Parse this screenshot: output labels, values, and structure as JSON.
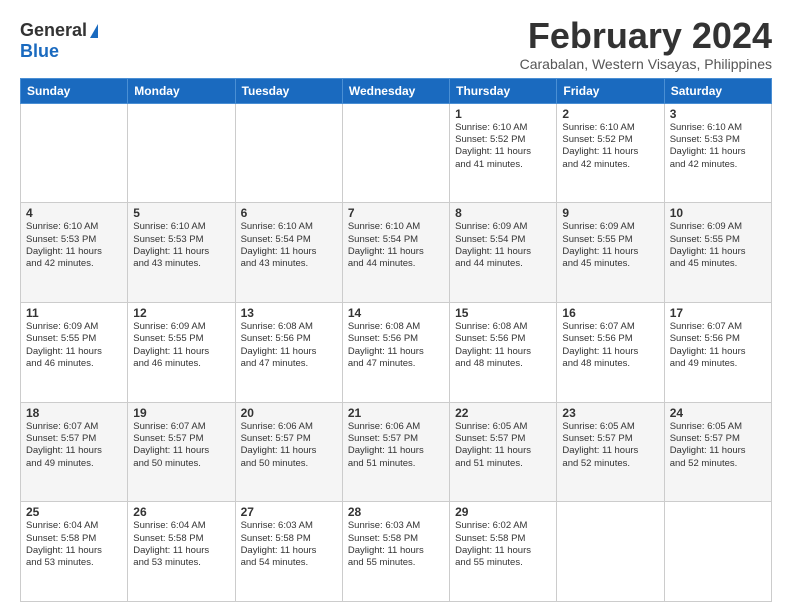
{
  "logo": {
    "general": "General",
    "blue": "Blue"
  },
  "title": {
    "month_year": "February 2024",
    "location": "Carabalan, Western Visayas, Philippines"
  },
  "days_of_week": [
    "Sunday",
    "Monday",
    "Tuesday",
    "Wednesday",
    "Thursday",
    "Friday",
    "Saturday"
  ],
  "weeks": [
    {
      "style": "row-white",
      "days": [
        {
          "num": "",
          "info": ""
        },
        {
          "num": "",
          "info": ""
        },
        {
          "num": "",
          "info": ""
        },
        {
          "num": "",
          "info": ""
        },
        {
          "num": "1",
          "info": "Sunrise: 6:10 AM\nSunset: 5:52 PM\nDaylight: 11 hours\nand 41 minutes."
        },
        {
          "num": "2",
          "info": "Sunrise: 6:10 AM\nSunset: 5:52 PM\nDaylight: 11 hours\nand 42 minutes."
        },
        {
          "num": "3",
          "info": "Sunrise: 6:10 AM\nSunset: 5:53 PM\nDaylight: 11 hours\nand 42 minutes."
        }
      ]
    },
    {
      "style": "row-gray",
      "days": [
        {
          "num": "4",
          "info": "Sunrise: 6:10 AM\nSunset: 5:53 PM\nDaylight: 11 hours\nand 42 minutes."
        },
        {
          "num": "5",
          "info": "Sunrise: 6:10 AM\nSunset: 5:53 PM\nDaylight: 11 hours\nand 43 minutes."
        },
        {
          "num": "6",
          "info": "Sunrise: 6:10 AM\nSunset: 5:54 PM\nDaylight: 11 hours\nand 43 minutes."
        },
        {
          "num": "7",
          "info": "Sunrise: 6:10 AM\nSunset: 5:54 PM\nDaylight: 11 hours\nand 44 minutes."
        },
        {
          "num": "8",
          "info": "Sunrise: 6:09 AM\nSunset: 5:54 PM\nDaylight: 11 hours\nand 44 minutes."
        },
        {
          "num": "9",
          "info": "Sunrise: 6:09 AM\nSunset: 5:55 PM\nDaylight: 11 hours\nand 45 minutes."
        },
        {
          "num": "10",
          "info": "Sunrise: 6:09 AM\nSunset: 5:55 PM\nDaylight: 11 hours\nand 45 minutes."
        }
      ]
    },
    {
      "style": "row-white",
      "days": [
        {
          "num": "11",
          "info": "Sunrise: 6:09 AM\nSunset: 5:55 PM\nDaylight: 11 hours\nand 46 minutes."
        },
        {
          "num": "12",
          "info": "Sunrise: 6:09 AM\nSunset: 5:55 PM\nDaylight: 11 hours\nand 46 minutes."
        },
        {
          "num": "13",
          "info": "Sunrise: 6:08 AM\nSunset: 5:56 PM\nDaylight: 11 hours\nand 47 minutes."
        },
        {
          "num": "14",
          "info": "Sunrise: 6:08 AM\nSunset: 5:56 PM\nDaylight: 11 hours\nand 47 minutes."
        },
        {
          "num": "15",
          "info": "Sunrise: 6:08 AM\nSunset: 5:56 PM\nDaylight: 11 hours\nand 48 minutes."
        },
        {
          "num": "16",
          "info": "Sunrise: 6:07 AM\nSunset: 5:56 PM\nDaylight: 11 hours\nand 48 minutes."
        },
        {
          "num": "17",
          "info": "Sunrise: 6:07 AM\nSunset: 5:56 PM\nDaylight: 11 hours\nand 49 minutes."
        }
      ]
    },
    {
      "style": "row-gray",
      "days": [
        {
          "num": "18",
          "info": "Sunrise: 6:07 AM\nSunset: 5:57 PM\nDaylight: 11 hours\nand 49 minutes."
        },
        {
          "num": "19",
          "info": "Sunrise: 6:07 AM\nSunset: 5:57 PM\nDaylight: 11 hours\nand 50 minutes."
        },
        {
          "num": "20",
          "info": "Sunrise: 6:06 AM\nSunset: 5:57 PM\nDaylight: 11 hours\nand 50 minutes."
        },
        {
          "num": "21",
          "info": "Sunrise: 6:06 AM\nSunset: 5:57 PM\nDaylight: 11 hours\nand 51 minutes."
        },
        {
          "num": "22",
          "info": "Sunrise: 6:05 AM\nSunset: 5:57 PM\nDaylight: 11 hours\nand 51 minutes."
        },
        {
          "num": "23",
          "info": "Sunrise: 6:05 AM\nSunset: 5:57 PM\nDaylight: 11 hours\nand 52 minutes."
        },
        {
          "num": "24",
          "info": "Sunrise: 6:05 AM\nSunset: 5:57 PM\nDaylight: 11 hours\nand 52 minutes."
        }
      ]
    },
    {
      "style": "row-white",
      "days": [
        {
          "num": "25",
          "info": "Sunrise: 6:04 AM\nSunset: 5:58 PM\nDaylight: 11 hours\nand 53 minutes."
        },
        {
          "num": "26",
          "info": "Sunrise: 6:04 AM\nSunset: 5:58 PM\nDaylight: 11 hours\nand 53 minutes."
        },
        {
          "num": "27",
          "info": "Sunrise: 6:03 AM\nSunset: 5:58 PM\nDaylight: 11 hours\nand 54 minutes."
        },
        {
          "num": "28",
          "info": "Sunrise: 6:03 AM\nSunset: 5:58 PM\nDaylight: 11 hours\nand 55 minutes."
        },
        {
          "num": "29",
          "info": "Sunrise: 6:02 AM\nSunset: 5:58 PM\nDaylight: 11 hours\nand 55 minutes."
        },
        {
          "num": "",
          "info": ""
        },
        {
          "num": "",
          "info": ""
        }
      ]
    }
  ]
}
